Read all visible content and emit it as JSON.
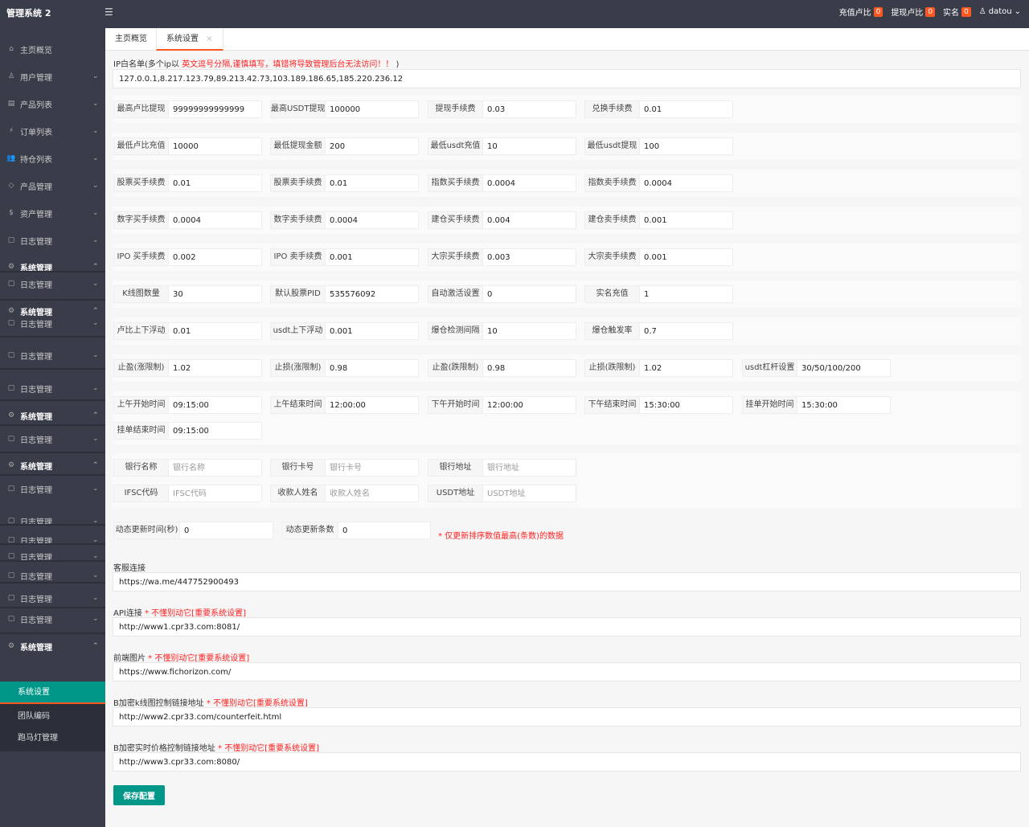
{
  "header": {
    "title": "管理系统 2",
    "toggle_icon": "☰",
    "recharge_label": "充值卢比",
    "recharge_count": "0",
    "withdraw_label": "提现卢比",
    "withdraw_count": "0",
    "realname_label": "实名",
    "realname_count": "0",
    "user": "datou"
  },
  "sidebar": {
    "items": [
      {
        "label": "主页概览",
        "icon": "⌂",
        "chev": ""
      },
      {
        "label": "用户管理",
        "icon": "♙",
        "chev": "⌄"
      },
      {
        "label": "产品列表",
        "icon": "▤",
        "chev": "⌄"
      },
      {
        "label": "订单列表",
        "icon": "⚡",
        "chev": "⌄"
      },
      {
        "label": "持仓列表",
        "icon": "👥",
        "chev": "⌄"
      },
      {
        "label": "产品管理",
        "icon": "◇",
        "chev": "⌄"
      },
      {
        "label": "资产管理",
        "icon": "$",
        "chev": "⌄"
      },
      {
        "label": "日志管理",
        "icon": "▢",
        "chev": "⌄"
      },
      {
        "label": "系统管理",
        "icon": "⚙",
        "chev": "⌃"
      },
      {
        "label": "日志管理",
        "icon": "▢",
        "chev": "⌄"
      },
      {
        "label": "系统管理",
        "icon": "⚙",
        "chev": "⌃"
      },
      {
        "label": "日志管理",
        "icon": "▢",
        "chev": "⌄"
      },
      {
        "label": "日志管理",
        "icon": "▢",
        "chev": "⌄"
      },
      {
        "label": "日志管理",
        "icon": "▢",
        "chev": "⌄"
      },
      {
        "label": "系统管理",
        "icon": "⚙",
        "chev": "⌃"
      },
      {
        "label": "日志管理",
        "icon": "▢",
        "chev": "⌄"
      },
      {
        "label": "系统管理",
        "icon": "⚙",
        "chev": "⌃"
      },
      {
        "label": "日志管理",
        "icon": "▢",
        "chev": "⌄"
      },
      {
        "label": "日志管理",
        "icon": "▢",
        "chev": "⌄"
      },
      {
        "label": "日志管理",
        "icon": "▢",
        "chev": "⌄"
      },
      {
        "label": "日志管理",
        "icon": "▢",
        "chev": "⌄"
      },
      {
        "label": "日志管理",
        "icon": "▢",
        "chev": "⌄"
      },
      {
        "label": "日志管理",
        "icon": "▢",
        "chev": "⌄"
      },
      {
        "label": "日志管理",
        "icon": "▢",
        "chev": "⌄"
      },
      {
        "label": "系统管理",
        "icon": "⚙",
        "chev": "⌃"
      }
    ],
    "sub": [
      "系统设置",
      "团队编码",
      "跑马灯管理"
    ]
  },
  "tabs": [
    {
      "label": "主页概览"
    },
    {
      "label": "系统设置",
      "close": "×"
    }
  ],
  "ip": {
    "label": "IP白名单(多个ip以 ",
    "warn": "英文逗号分隔,谨慎填写，填错将导致管理后台无法访问！！",
    "end": " )",
    "value": "127.0.0.1,8.217.123.79,89.213.42.73,103.189.186.65,185.220.236.12"
  },
  "rows": [
    [
      [
        "最高卢比提现",
        "99999999999999"
      ],
      [
        "最高USDT提现",
        "100000"
      ],
      [
        "提现手续费",
        "0.03"
      ],
      [
        "兑换手续费",
        "0.01"
      ]
    ],
    [
      [
        "最低卢比充值",
        "10000"
      ],
      [
        "最低提现金额",
        "200"
      ],
      [
        "最低usdt充值",
        "10"
      ],
      [
        "最低usdt提现",
        "100"
      ]
    ],
    [
      [
        "股票买手续费",
        "0.01"
      ],
      [
        "股票卖手续费",
        "0.01"
      ],
      [
        "指数买手续费",
        "0.0004"
      ],
      [
        "指数卖手续费",
        "0.0004"
      ]
    ],
    [
      [
        "数字买手续费",
        "0.0004"
      ],
      [
        "数字卖手续费",
        "0.0004"
      ],
      [
        "建仓买手续费",
        "0.004"
      ],
      [
        "建仓卖手续费",
        "0.001"
      ]
    ],
    [
      [
        "IPO 买手续费",
        "0.002"
      ],
      [
        "IPO 卖手续费",
        "0.001"
      ],
      [
        "大宗买手续费",
        "0.003"
      ],
      [
        "大宗卖手续费",
        "0.001"
      ]
    ],
    [
      [
        "K线图数量",
        "30"
      ],
      [
        "默认股票PID",
        "535576092"
      ],
      [
        "自动激活设置",
        "0"
      ],
      [
        "实名充值",
        "1"
      ]
    ],
    [
      [
        "卢比上下浮动",
        "0.01"
      ],
      [
        "usdt上下浮动",
        "0.001"
      ],
      [
        "爆仓检测间隔",
        "10"
      ],
      [
        "爆仓触发率",
        "0.7"
      ]
    ],
    [
      [
        "止盈(涨限制)",
        "1.02"
      ],
      [
        "止损(涨限制)",
        "0.98"
      ],
      [
        "止盈(跌限制)",
        "0.98"
      ],
      [
        "止损(跌限制)",
        "1.02"
      ],
      [
        "usdt杠杆设置",
        "30/50/100/200"
      ]
    ],
    [
      [
        "上午开始时间",
        "09:15:00"
      ],
      [
        "上午结束时间",
        "12:00:00"
      ],
      [
        "下午开始时间",
        "12:00:00"
      ],
      [
        "下午结束时间",
        "15:30:00"
      ],
      [
        "挂单开始时间",
        "15:30:00"
      ]
    ],
    [
      [
        "挂单结束时间",
        "09:15:00"
      ]
    ]
  ],
  "bank": [
    [
      [
        "银行名称",
        "",
        "银行名称"
      ],
      [
        "银行卡号",
        "",
        "银行卡号"
      ],
      [
        "银行地址",
        "",
        "银行地址"
      ]
    ],
    [
      [
        "IFSC代码",
        "",
        "IFSC代码"
      ],
      [
        "收款人姓名",
        "",
        "收款人姓名"
      ],
      [
        "USDT地址",
        "",
        "USDT地址"
      ]
    ]
  ],
  "dyn": {
    "time_label": "动态更新时间(秒)",
    "time_value": "0",
    "count_label": "动态更新条数",
    "count_value": "0",
    "note": "* 仅更新排序数值最高(条数)的数据"
  },
  "links": [
    {
      "label": "客服连接",
      "warn": "",
      "value": "https://wa.me/447752900493"
    },
    {
      "label": "API连接",
      "warn": " * 不懂别动它[重要系统设置]",
      "value": "http://www1.cpr33.com:8081/"
    },
    {
      "label": "前端图片",
      "warn": " * 不懂别动它[重要系统设置]",
      "value": "https://www.fichorizon.com/"
    },
    {
      "label": "B加密k线图控制链接地址",
      "warn": " * 不懂别动它[重要系统设置]",
      "value": "http://www2.cpr33.com/counterfeit.html"
    },
    {
      "label": "B加密实时价格控制链接地址",
      "warn": " * 不懂别动它[重要系统设置]",
      "value": "http://www3.cpr33.com:8080/"
    }
  ],
  "save_label": "保存配置"
}
